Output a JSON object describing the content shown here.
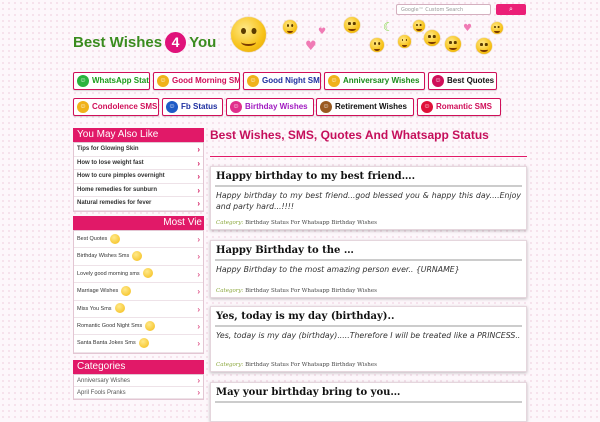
{
  "header": {
    "logo_left": "Best Wishes",
    "logo_num": "4",
    "logo_right": "You",
    "search_placeholder": "Google™ Custom Search",
    "search_button": "⌕"
  },
  "nav": [
    {
      "label": "WhatsApp Status",
      "icon": "whatsapp-icon",
      "color": "#1a9c1a",
      "icolor": "#2bb33c"
    },
    {
      "label": "Good Morning SMS",
      "icon": "sun-smiley-icon",
      "color": "#d00f59",
      "icolor": "#f0b21a"
    },
    {
      "label": "Good Night SMS",
      "icon": "moon-smiley-icon",
      "color": "#1e2fa0",
      "icolor": "#f0b21a"
    },
    {
      "label": "Anniversary Wishes",
      "icon": "rings-icon",
      "color": "#1a8c1a",
      "icolor": "#f0b21a"
    },
    {
      "label": "Best Quotes",
      "icon": "quote-bubble-icon",
      "color": "#111111",
      "icolor": "#d00f59"
    },
    {
      "label": "Condolence SMS",
      "icon": "sad-smiley-icon",
      "color": "#d00f59",
      "icolor": "#f0b21a"
    },
    {
      "label": "Fb Status",
      "icon": "facebook-icon",
      "color": "#1e2fa0",
      "icolor": "#1e5bc6"
    },
    {
      "label": "Birthday Wishes",
      "icon": "gift-icon",
      "color": "#a01ac0",
      "icolor": "#e12f8c"
    },
    {
      "label": "Retirement Wishes",
      "icon": "cake-icon",
      "color": "#111111",
      "icolor": "#9a5a20"
    },
    {
      "label": "Romantic SMS",
      "icon": "hearts-icon",
      "color": "#d00f59",
      "icolor": "#e0123a"
    }
  ],
  "sidebar": {
    "may_like_title": "You May Also Like",
    "may_like": [
      "Tips for Glowing Skin",
      "How to lose weight fast",
      "How to cure pimples overnight",
      "Home remedies for sunburn",
      "Natural remedies for fever"
    ],
    "most_viewed_title": "Most Vie",
    "most_viewed": [
      "Best Quotes",
      "Birthday Wishes Sms",
      "Lovely good morning sms",
      "Marriage Wishes",
      "Miss You Sms",
      "Romantic Good Night Sms",
      "Santa Banta Jokes Sms"
    ],
    "categories_title": "Categories",
    "categories": [
      "Anniversary Wishes",
      "April Fools Pranks"
    ],
    "arrow": "›"
  },
  "main": {
    "title": "Best Wishes, SMS, Quotes And Whatsapp Status",
    "category_label": "Category:",
    "posts": [
      {
        "title": "Happy birthday to my best friend….",
        "body": "Happy birthday to my best friend...god blessed you & happy this day....Enjoy and party hard...!!!!",
        "cat1": "Birthday Status For Whatsapp",
        "cat2": "Birthday Wishes"
      },
      {
        "title": "Happy Birthday to the …",
        "body": "Happy Birthday to the most amazing person ever.. {URNAME}",
        "cat1": "Birthday Status For Whatsapp",
        "cat2": "Birthday Wishes"
      },
      {
        "title": "Yes, today is my day (birthday)..",
        "body": "Yes, today is my day (birthday).....Therefore I will be treated like a PRINCESS..",
        "cat1": "Birthday Status For Whatsapp",
        "cat2": "Birthday Wishes"
      },
      {
        "title": "May your birthday bring to you…",
        "body": "",
        "cat1": "",
        "cat2": ""
      }
    ]
  }
}
